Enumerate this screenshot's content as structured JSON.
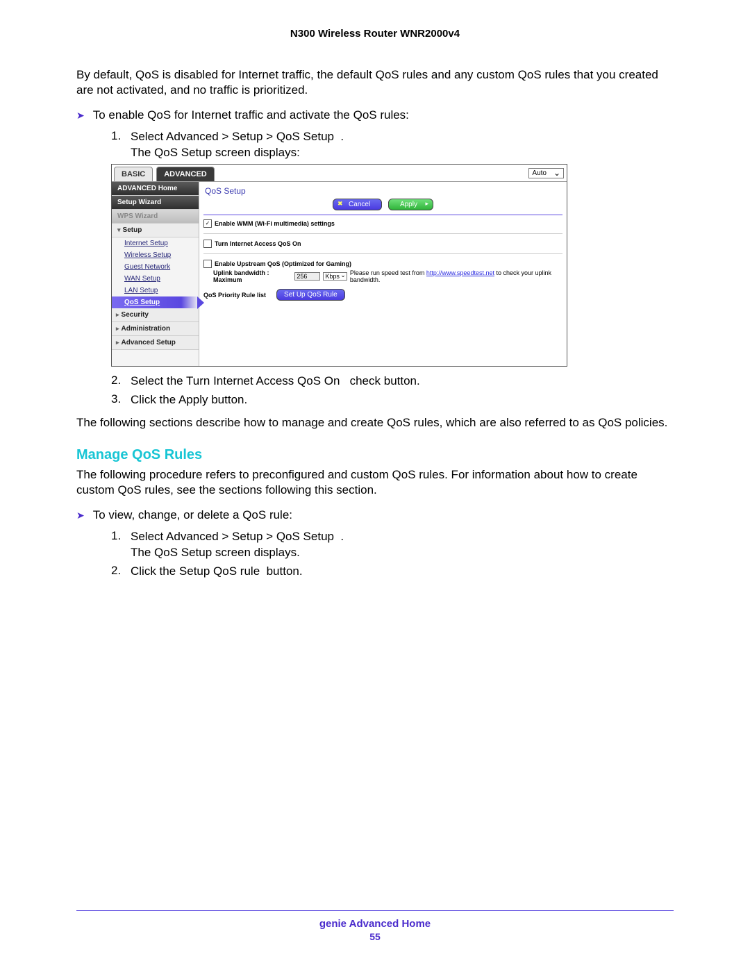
{
  "doc_title": "N300 Wireless Router WNR2000v4",
  "intro": "By default, QoS is disabled for Internet traffic, the default QoS rules and any custom QoS rules that you created are not activated, and no traffic is prioritized.",
  "enable_lead": "To enable QoS for Internet traffic and activate the QoS rules:",
  "enable_steps": {
    "s1a": "Select Advanced > Setup > QoS Setup  .",
    "s1b": "The QoS Setup screen displays:",
    "s2": "Select the Turn Internet Access QoS On   check button.",
    "s3": "Click the Apply button."
  },
  "after_enable": "The following sections describe how to manage and create QoS rules, which are also referred to as QoS policies.",
  "manage_head": "Manage QoS Rules",
  "manage_intro": "The following procedure refers to preconfigured and custom QoS rules. For information about how to create custom QoS rules, see the sections following this section.",
  "view_lead": "To view, change, or delete a QoS rule:",
  "view_steps": {
    "s1a": "Select Advanced > Setup > QoS Setup  .",
    "s1b": "The QoS Setup screen displays.",
    "s2": "Click the Setup QoS rule  button."
  },
  "footer_label": "genie Advanced Home",
  "footer_page": "55",
  "shot": {
    "tab_basic": "BASIC",
    "tab_advanced": "ADVANCED",
    "auto": "Auto",
    "sidebar": {
      "adv_home": "ADVANCED Home",
      "setup_wizard": "Setup Wizard",
      "wps_wizard": "WPS Wizard",
      "setup": "Setup",
      "items": [
        "Internet Setup",
        "Wireless Setup",
        "Guest Network",
        "WAN Setup",
        "LAN Setup",
        "QoS Setup"
      ],
      "security": "Security",
      "administration": "Administration",
      "advanced_setup": "Advanced Setup"
    },
    "content": {
      "title": "QoS Setup",
      "cancel": "Cancel",
      "apply": "Apply",
      "enable_wmm": "Enable WMM (Wi-Fi multimedia) settings",
      "turn_on": "Turn Internet Access QoS On",
      "enable_upstream": "Enable Upstream QoS (Optimized for Gaming)",
      "uplink_label": "Uplink bandwidth :   Maximum",
      "uplink_value": "256",
      "uplink_unit": "Kbps",
      "speed_prefix": "Please run speed test from ",
      "speed_link": "http://www.speedtest.net",
      "speed_suffix": " to check your uplink bandwidth.",
      "rule_list": "QoS Priority Rule list",
      "setup_rule": "Set Up QoS Rule"
    }
  }
}
